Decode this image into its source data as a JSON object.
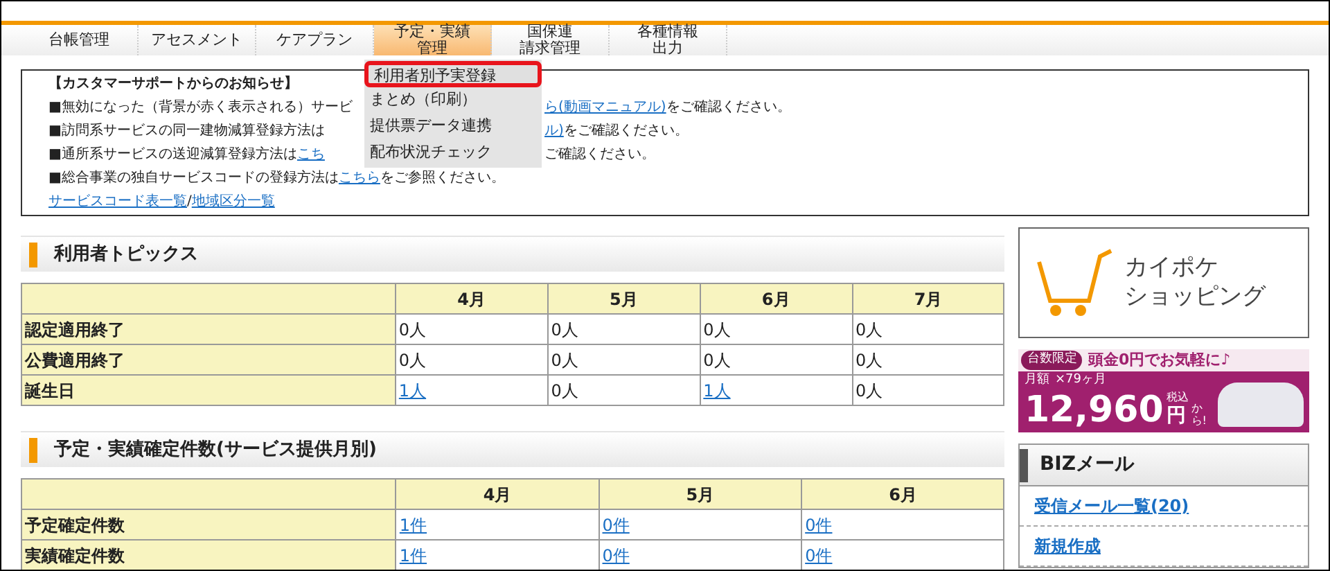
{
  "nav": [
    {
      "lines": [
        "台帳管理"
      ],
      "selected": false
    },
    {
      "lines": [
        "アセスメント"
      ],
      "selected": false
    },
    {
      "lines": [
        "ケアプラン"
      ],
      "selected": false
    },
    {
      "lines": [
        "予定・実績",
        "管理"
      ],
      "selected": true
    },
    {
      "lines": [
        "国保連",
        "請求管理"
      ],
      "selected": false
    },
    {
      "lines": [
        "各種情報",
        "出力"
      ],
      "selected": false
    }
  ],
  "dropdown": [
    {
      "label": "利用者別予実登録",
      "selected": true
    },
    {
      "label": "まとめ（印刷）",
      "selected": false
    },
    {
      "label": "提供票データ連携",
      "selected": false
    },
    {
      "label": "配布状況チェック",
      "selected": false
    }
  ],
  "notice": {
    "title": "【カスタマーサポートからのお知らせ】",
    "lines": [
      [
        {
          "kind": "text",
          "text": "■無効になった（背景が赤く表示される）サービ"
        },
        {
          "kind": "gap"
        },
        {
          "kind": "link",
          "text": "ら(動画マニュアル)"
        },
        {
          "kind": "text",
          "text": "をご確認ください。"
        }
      ],
      [
        {
          "kind": "text",
          "text": "■訪問系サービスの同一建物減算登録方法は"
        },
        {
          "kind": "gap"
        },
        {
          "kind": "link",
          "text": "ル)"
        },
        {
          "kind": "text",
          "text": "をご確認ください。"
        }
      ],
      [
        {
          "kind": "text",
          "text": "■通所系サービスの送迎減算登録方法は"
        },
        {
          "kind": "link",
          "text": "こち"
        },
        {
          "kind": "gap"
        },
        {
          "kind": "text",
          "text": "ご確認ください。"
        }
      ],
      [
        {
          "kind": "text",
          "text": "■総合事業の独自サービスコードの登録方法は"
        },
        {
          "kind": "link",
          "text": "こちら"
        },
        {
          "kind": "text",
          "text": "をご参照ください。"
        }
      ],
      [
        {
          "kind": "link",
          "text": "サービスコード表一覧"
        },
        {
          "kind": "text",
          "text": " / "
        },
        {
          "kind": "link",
          "text": "地域区分一覧"
        }
      ]
    ]
  },
  "topics": {
    "title": "利用者トピックス",
    "columns": [
      "4月",
      "5月",
      "6月",
      "7月"
    ],
    "rows": [
      {
        "label": "認定適用終了",
        "cells": [
          {
            "text": "0人",
            "link": false
          },
          {
            "text": "0人",
            "link": false
          },
          {
            "text": "0人",
            "link": false
          },
          {
            "text": "0人",
            "link": false
          }
        ]
      },
      {
        "label": "公費適用終了",
        "cells": [
          {
            "text": "0人",
            "link": false
          },
          {
            "text": "0人",
            "link": false
          },
          {
            "text": "0人",
            "link": false
          },
          {
            "text": "0人",
            "link": false
          }
        ]
      },
      {
        "label": "誕生日",
        "cells": [
          {
            "text": "1人",
            "link": true
          },
          {
            "text": "0人",
            "link": false
          },
          {
            "text": "1人",
            "link": true
          },
          {
            "text": "0人",
            "link": false
          }
        ]
      }
    ]
  },
  "counts": {
    "title": "予定・実績確定件数(サービス提供月別)",
    "columns": [
      "4月",
      "5月",
      "6月"
    ],
    "rows": [
      {
        "label": "予定確定件数",
        "cells": [
          {
            "text": "1件",
            "link": true
          },
          {
            "text": "0件",
            "link": true
          },
          {
            "text": "0件",
            "link": true
          }
        ]
      },
      {
        "label": "実績確定件数",
        "cells": [
          {
            "text": "1件",
            "link": true
          },
          {
            "text": "0件",
            "link": true
          },
          {
            "text": "0件",
            "link": true
          }
        ]
      }
    ]
  },
  "shop_banner": {
    "line_1": "カイポケ",
    "line_2": "ショッピング"
  },
  "car_ad": {
    "badge": "台数限定",
    "headline": "頭金0円でお気軽に♪",
    "monthly": "月額",
    "term": "×79ヶ月",
    "price": "12,960",
    "yen": "円",
    "tax": "税込",
    "from": "から!"
  },
  "biz_mail": {
    "title": "BIZメール",
    "links": [
      "受信メール一覧(20)",
      "新規作成"
    ]
  }
}
